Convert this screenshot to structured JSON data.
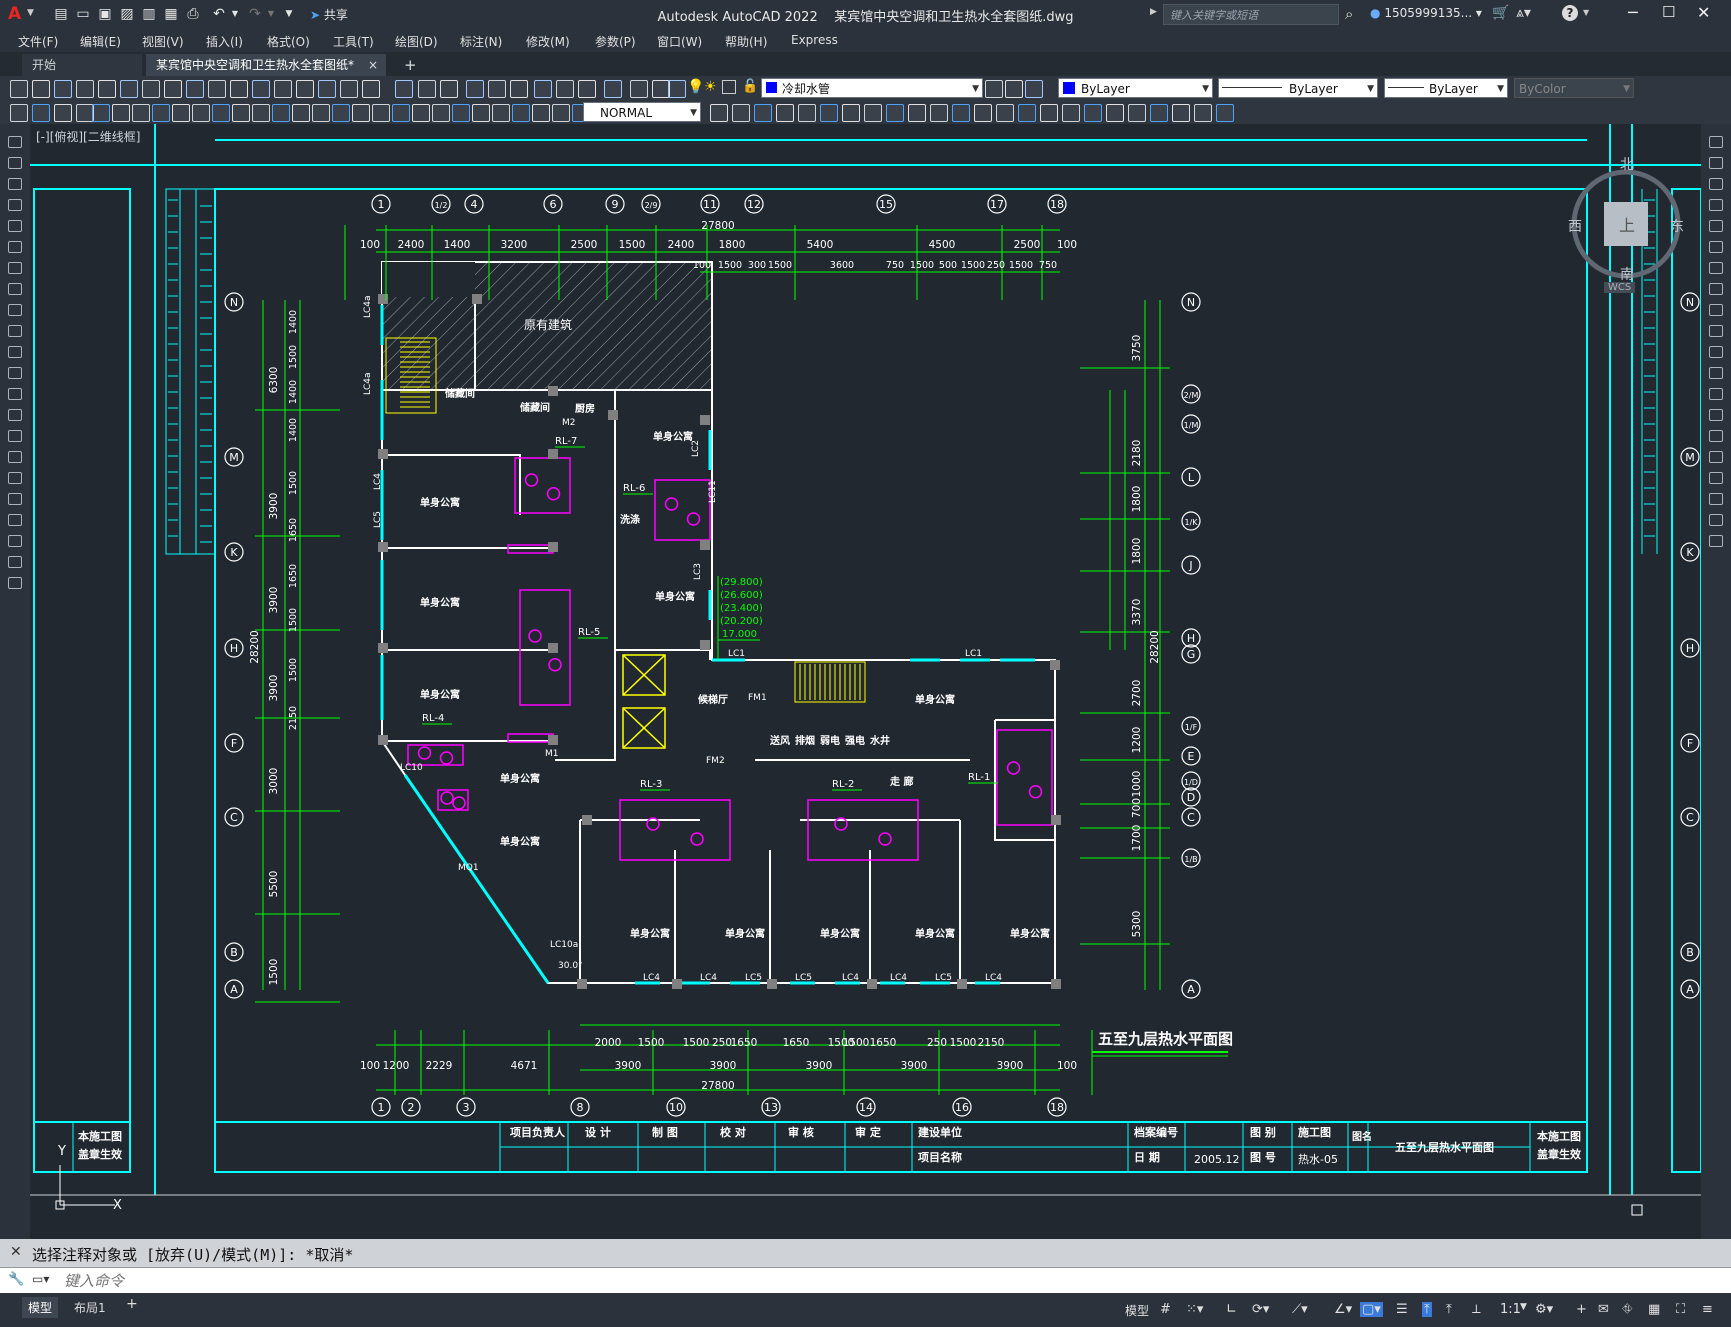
{
  "app": {
    "name": "Autodesk AutoCAD 2022",
    "file": "某宾馆中央空调和卫生热水全套图纸.dwg",
    "logo": "A",
    "share_label": "共享",
    "search_placeholder": "键入关键字或短语",
    "user": "1505999135...",
    "help": "?"
  },
  "menus": [
    "文件(F)",
    "编辑(E)",
    "视图(V)",
    "插入(I)",
    "格式(O)",
    "工具(T)",
    "绘图(D)",
    "标注(N)",
    "修改(M)",
    "参数(P)",
    "窗口(W)",
    "帮助(H)",
    "Express"
  ],
  "tabs": {
    "start": "开始",
    "active": "某宾馆中央空调和卫生热水全套图纸*",
    "close": "×",
    "new": "+"
  },
  "properties": {
    "layer": "冷却水管",
    "color": "ByLayer",
    "linetype": "ByLayer",
    "lineweight": "ByLayer",
    "plotstyle": "ByColor",
    "textstyle": "NORMAL"
  },
  "viewport_label": "[-][俯视][二维线框]",
  "viewcube": {
    "north": "北",
    "south": "南",
    "east": "东",
    "west": "西",
    "top": "上",
    "wcs": "WCS"
  },
  "drawing": {
    "title": "五至九层热水平面图",
    "top_axes": [
      "1",
      "1/2",
      "4",
      "6",
      "9",
      "2/9",
      "11",
      "12",
      "15",
      "17",
      "18"
    ],
    "bottom_axes": [
      "1",
      "2",
      "3",
      "8",
      "10",
      "13",
      "14",
      "16",
      "18"
    ],
    "left_axes": [
      "N",
      "M",
      "K",
      "H",
      "F",
      "C",
      "B",
      "A"
    ],
    "right_axes": [
      "N",
      "2/M",
      "1/M",
      "L",
      "1/K",
      "J",
      "H",
      "G",
      "1/F",
      "E",
      "1/D",
      "D",
      "C",
      "1/B",
      "A"
    ],
    "top_dims": [
      "100",
      "2400",
      "1400",
      "3200",
      "2500",
      "1500",
      "2400",
      "1800",
      "5400",
      "4500",
      "2500",
      "100"
    ],
    "top_subdims": [
      "100",
      "1500",
      "300",
      "1500",
      "3600",
      "750",
      "1500",
      "500",
      "1500",
      "250",
      "1500",
      "750"
    ],
    "overall": "27800",
    "bottom_dims_row1": [
      "2000",
      "1500",
      "1500",
      "250",
      "1650",
      "1650",
      "1500",
      "1500",
      "1650",
      "250",
      "1500",
      "2150"
    ],
    "bottom_dims_row2": [
      "100",
      "1200",
      "2229",
      "4671",
      "3900",
      "3900",
      "3900",
      "3900",
      "3900",
      "100"
    ],
    "left_dims": [
      "6300",
      "3900",
      "3900",
      "3900",
      "3000",
      "5500",
      "1500"
    ],
    "left_subdims": [
      "1400",
      "1500",
      "1400",
      "1400",
      "1500",
      "1650",
      "1650",
      "1500",
      "1500",
      "2150"
    ],
    "left_total": "28200",
    "right_dims": [
      "3750",
      "2180",
      "1800",
      "1800",
      "3370",
      "2700",
      "1200",
      "1000",
      "700",
      "1700",
      "5300"
    ],
    "right_total": "28200",
    "rooms": {
      "existing": "原有建筑",
      "single": "单身公寓",
      "storage": "储藏间",
      "kitchen": "厨房",
      "lobby": "候梯厅",
      "corridor": "走    廊",
      "shafts": [
        "送风",
        "排烟",
        "弱电",
        "强电",
        "水井"
      ],
      "wash": "洗涤"
    },
    "risers": [
      "RL-1",
      "RL-2",
      "RL-3",
      "RL-4",
      "RL-5",
      "RL-6",
      "RL-7"
    ],
    "elevations": [
      "(29.800)",
      "(26.600)",
      "(23.400)",
      "(20.200)",
      "17.000"
    ],
    "windows": [
      "LC1",
      "LC2",
      "LC3",
      "LC4",
      "LC5",
      "LC4a",
      "LC10",
      "LC10a",
      "LC11"
    ],
    "doors": [
      "M2",
      "M1",
      "MQ1",
      "FM1",
      "FM2"
    ],
    "angle": "30.0°"
  },
  "titleblock": {
    "left_stamp": [
      "本施工图",
      "盖章生效"
    ],
    "roles": [
      "项目负责人",
      "设  计",
      "制  图",
      "校  对",
      "审  核",
      "审  定"
    ],
    "unit": "建设单位",
    "project": "项目名称",
    "archive": "档案编号",
    "date_label": "日  期",
    "date": "2005.12",
    "category_label": "图  别",
    "category": "施工图",
    "number_label": "图  号",
    "number": "热水-05",
    "name_label": "图名",
    "name": "五至九层热水平面图",
    "right_stamp": [
      "本施工图",
      "盖章生效"
    ]
  },
  "command": {
    "history": "选择注释对象或 [放弃(U)/模式(M)]: *取消*",
    "placeholder": "键入命令"
  },
  "status": {
    "layout_tabs": [
      "模型",
      "布局1"
    ],
    "model": "模型",
    "scale": "1:1"
  },
  "colors": {
    "bg": "#212830",
    "cyan": "#00ffff",
    "green": "#00ff00",
    "magenta": "#ff00ff",
    "yellow": "#ffff00",
    "white": "#ffffff"
  }
}
